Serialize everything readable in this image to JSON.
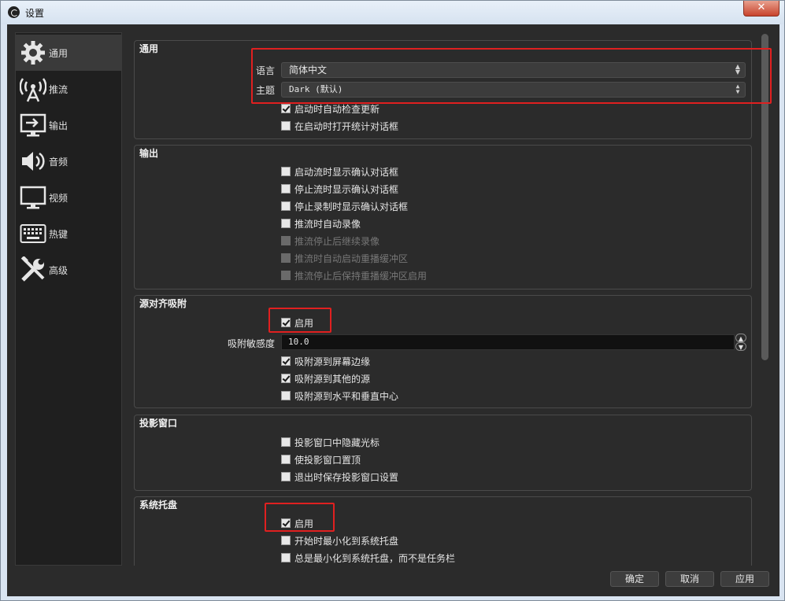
{
  "window": {
    "title": "设置",
    "close_glyph": "✕"
  },
  "sidebar": {
    "items": [
      {
        "label": "通用",
        "icon": "gear-icon",
        "active": true
      },
      {
        "label": "推流",
        "icon": "broadcast-antenna-icon"
      },
      {
        "label": "输出",
        "icon": "output-monitor-icon"
      },
      {
        "label": "音频",
        "icon": "speaker-icon"
      },
      {
        "label": "视频",
        "icon": "monitor-icon"
      },
      {
        "label": "热键",
        "icon": "keyboard-icon"
      },
      {
        "label": "高级",
        "icon": "wrench-screwdriver-icon"
      }
    ]
  },
  "general": {
    "title": "通用",
    "language_label": "语言",
    "language_value": "简体中文",
    "theme_label": "主题",
    "theme_value": "Dark (默认)",
    "check_updates": {
      "label": "启动时自动检查更新",
      "checked": true
    },
    "open_stats": {
      "label": "在启动时打开统计对话框",
      "checked": false
    }
  },
  "output": {
    "title": "输出",
    "options": [
      {
        "label": "启动流时显示确认对话框",
        "checked": false,
        "enabled": true
      },
      {
        "label": "停止流时显示确认对话框",
        "checked": false,
        "enabled": true
      },
      {
        "label": "停止录制时显示确认对话框",
        "checked": false,
        "enabled": true
      },
      {
        "label": "推流时自动录像",
        "checked": false,
        "enabled": true
      },
      {
        "label": "推流停止后继续录像",
        "checked": false,
        "enabled": false
      },
      {
        "label": "推流时自动启动重播缓冲区",
        "checked": false,
        "enabled": false
      },
      {
        "label": "推流停止后保持重播缓冲区启用",
        "checked": false,
        "enabled": false
      }
    ]
  },
  "snapping": {
    "title": "源对齐吸附",
    "enable": {
      "label": "启用",
      "checked": true
    },
    "sensitivity_label": "吸附敏感度",
    "sensitivity_value": "10.0",
    "options": [
      {
        "label": "吸附源到屏幕边缘",
        "checked": true
      },
      {
        "label": "吸附源到其他的源",
        "checked": true
      },
      {
        "label": "吸附源到水平和垂直中心",
        "checked": false
      }
    ]
  },
  "projectors": {
    "title": "投影窗口",
    "options": [
      {
        "label": "投影窗口中隐藏光标",
        "checked": false
      },
      {
        "label": "使投影窗口置顶",
        "checked": false
      },
      {
        "label": "退出时保存投影窗口设置",
        "checked": false
      }
    ]
  },
  "tray": {
    "title": "系统托盘",
    "enable": {
      "label": "启用",
      "checked": true
    },
    "options": [
      {
        "label": "开始时最小化到系统托盘",
        "checked": false
      },
      {
        "label": "总是最小化到系统托盘，而不是任务栏",
        "checked": false
      }
    ]
  },
  "buttons": {
    "ok": "确定",
    "cancel": "取消",
    "apply": "应用"
  },
  "highlight_color": "#e02020"
}
